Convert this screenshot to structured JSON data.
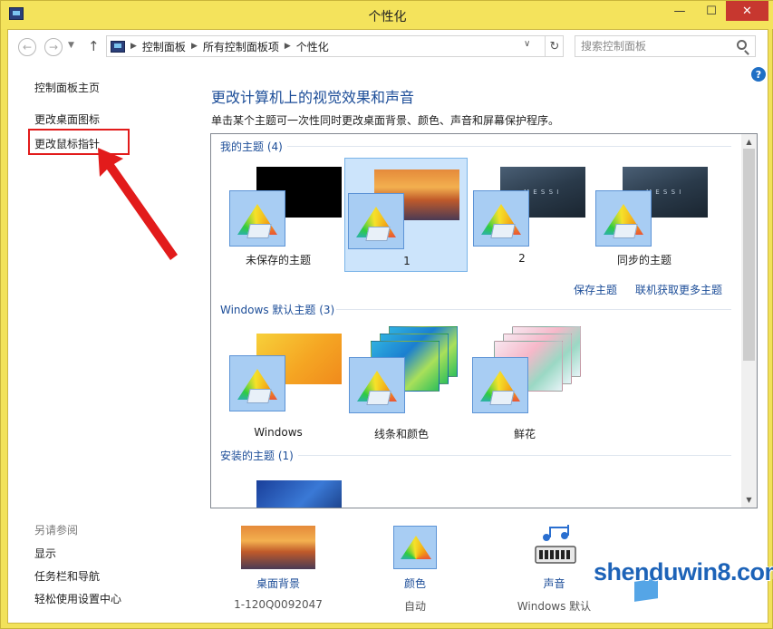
{
  "window": {
    "title": "个性化"
  },
  "address": {
    "crumbs": [
      "控制面板",
      "所有控制面板项",
      "个性化"
    ]
  },
  "search": {
    "placeholder": "搜索控制面板"
  },
  "left_pane": {
    "home": "控制面板主页",
    "change_desktop_icons": "更改桌面图标",
    "change_mouse_pointers": "更改鼠标指针",
    "see_also": "另请参阅",
    "display": "显示",
    "taskbar": "任务栏和导航",
    "ease": "轻松使用设置中心"
  },
  "main": {
    "heading": "更改计算机上的视觉效果和声音",
    "subtext": "单击某个主题可一次性同时更改桌面背景、颜色、声音和屏幕保护程序。",
    "groups": {
      "mine": "我的主题 (4)",
      "windows": "Windows 默认主题 (3)",
      "installed": "安装的主题 (1)"
    },
    "my_themes": [
      "未保存的主题",
      "1",
      "2",
      "同步的主题"
    ],
    "windows_themes": [
      "Windows",
      "线条和颜色",
      "鲜花"
    ],
    "save_theme": "保存主题",
    "get_more_online": "联机获取更多主题"
  },
  "settings": {
    "bg_title": "桌面背景",
    "bg_value": "1-120Q0092047",
    "color_title": "颜色",
    "color_value": "自动",
    "sound_title": "声音",
    "sound_value": "Windows 默认"
  },
  "watermark": "shenduwin8.com",
  "colors": {
    "titlebar": "#f4e35c",
    "link": "#1c4d98",
    "highlight": "#e21b1b",
    "selected": "#cce4fb"
  },
  "icons": [
    "back-icon",
    "forward-icon",
    "up-arrow-icon",
    "refresh-icon",
    "search-icon",
    "help-icon",
    "close-icon",
    "minimize-icon",
    "maximize-icon",
    "palette-icon",
    "sound-icon"
  ]
}
